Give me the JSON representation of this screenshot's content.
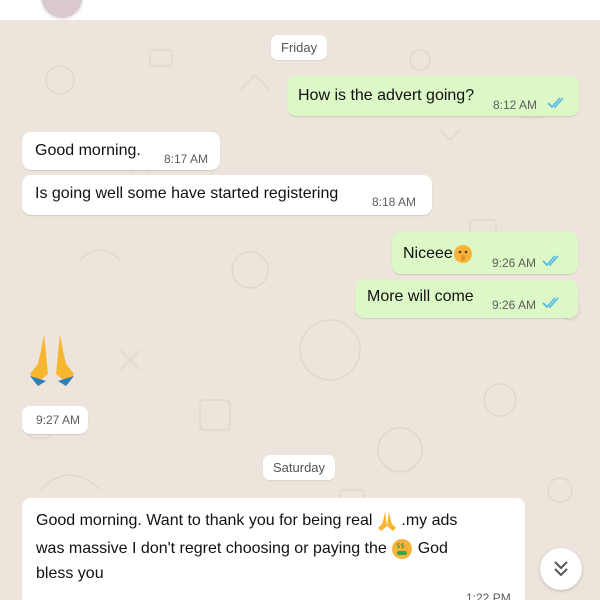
{
  "chat": {
    "days": [
      {
        "label": "Friday"
      },
      {
        "label": "Saturday"
      }
    ],
    "messages": [
      {
        "dir": "out",
        "text": "How is the advert going?",
        "time": "8:12 AM",
        "status": "read"
      },
      {
        "dir": "in",
        "text": "Good morning.",
        "time": "8:17 AM"
      },
      {
        "dir": "in",
        "text": "Is going well some have started registering",
        "time": "8:18 AM"
      },
      {
        "dir": "out",
        "text": "Niceee",
        "emoji": "shushing-face-emoji",
        "time": "9:26 AM",
        "status": "read"
      },
      {
        "dir": "out",
        "text": "More will come",
        "time": "9:26 AM",
        "status": "read"
      },
      {
        "dir": "in",
        "emoji": "folded-hands-emoji",
        "time": "9:27 AM"
      },
      {
        "dir": "in",
        "lines": [
          "Good morning. Want to thank you for being real",
          ".my ads",
          "was massive  I don't regret choosing or paying the",
          "God",
          "bless you"
        ],
        "inline_emojis": [
          "folded-hands-emoji",
          "money-mouth-face-emoji"
        ],
        "time": "1:22 PM"
      }
    ]
  },
  "colors": {
    "wallpaper": "#ede5db",
    "incoming_bubble": "#ffffff",
    "outgoing_bubble": "#dcf8c6",
    "read_ticks": "#4fb6ec"
  },
  "icons": {
    "scroll_down": "double-chevron-down-icon"
  }
}
